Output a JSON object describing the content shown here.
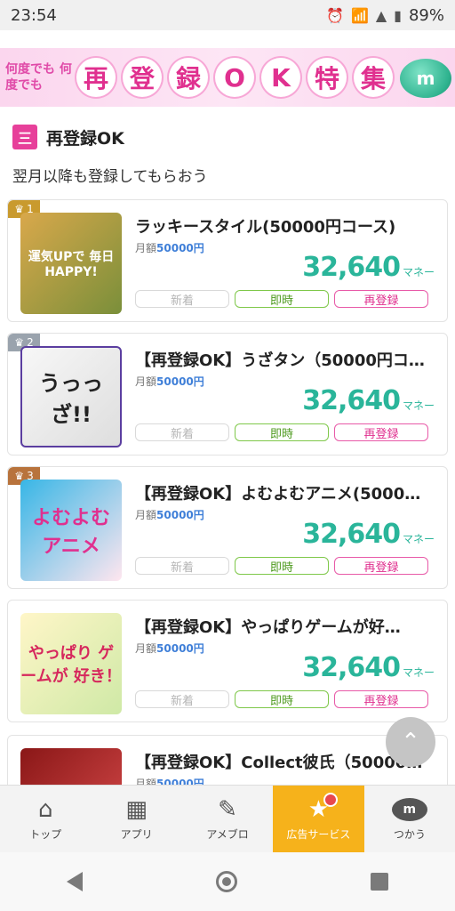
{
  "status": {
    "time": "23:54",
    "battery": "89%"
  },
  "banner": {
    "sub": "何度でも 何度でも",
    "chars": [
      "再",
      "登",
      "録",
      "O",
      "K",
      "特",
      "集"
    ],
    "coin": "m"
  },
  "section": {
    "icon": "三",
    "title": "再登録OK",
    "subtitle": "翌月以降も登録してもらおう"
  },
  "cards": [
    {
      "rank": "1",
      "title": "ラッキースタイル(50000円コース)",
      "price_label": "月額",
      "price": "50000円",
      "reward": "32,640",
      "unit": "マネー",
      "thumb": "運気UPで 毎日HAPPY!",
      "tags": [
        "新着",
        "即時",
        "再登録"
      ]
    },
    {
      "rank": "2",
      "title": "【再登録OK】うざタン（50000円コ…",
      "price_label": "月額",
      "price": "50000円",
      "reward": "32,640",
      "unit": "マネー",
      "thumb": "うっっざ!!",
      "tags": [
        "新着",
        "即時",
        "再登録"
      ]
    },
    {
      "rank": "3",
      "title": "【再登録OK】よむよむアニメ(5000…",
      "price_label": "月額",
      "price": "50000円",
      "reward": "32,640",
      "unit": "マネー",
      "thumb": "よむよむ アニメ",
      "tags": [
        "新着",
        "即時",
        "再登録"
      ]
    },
    {
      "rank": "",
      "title": "【再登録OK】やっぱりゲームが好…",
      "price_label": "月額",
      "price": "50000円",
      "reward": "32,640",
      "unit": "マネー",
      "thumb": "やっぱり ゲームが 好き！",
      "tags": [
        "新着",
        "即時",
        "再登録"
      ]
    },
    {
      "rank": "",
      "title": "【再登録OK】Collect彼氏（50000…",
      "price_label": "月額",
      "price": "50000円",
      "reward": "",
      "unit": "",
      "thumb": "",
      "tags": []
    }
  ],
  "tabbar": [
    {
      "label": "トップ",
      "icon": "home-icon"
    },
    {
      "label": "アプリ",
      "icon": "grid-icon"
    },
    {
      "label": "アメブロ",
      "icon": "pen-icon"
    },
    {
      "label": "広告サービス",
      "icon": "star-box-icon",
      "active": true
    },
    {
      "label": "つかう",
      "icon": "coin-icon"
    }
  ],
  "colors": {
    "accent_pink": "#e0308f",
    "reward_green": "#2ab59a",
    "tab_active": "#f6b21b"
  }
}
